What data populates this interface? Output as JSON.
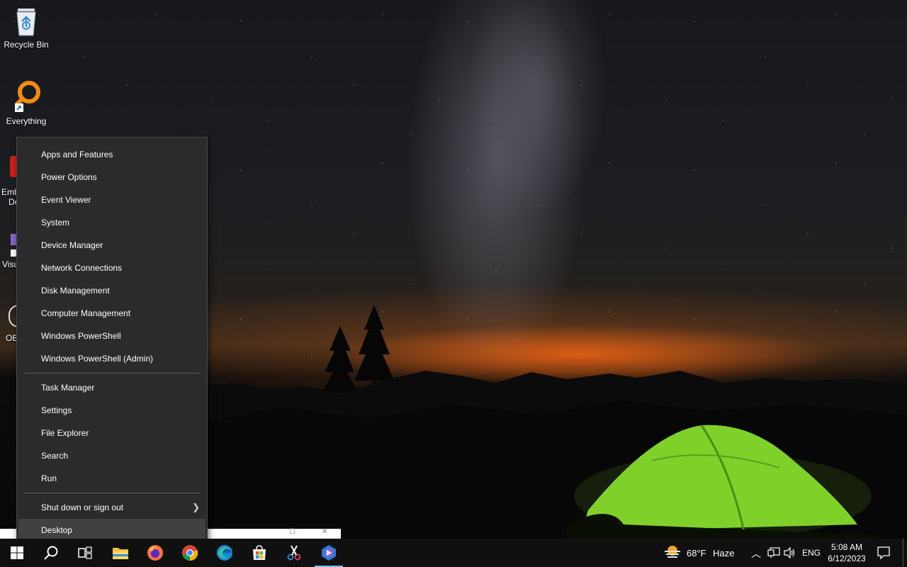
{
  "desktop_icons": [
    {
      "label": "Recycle Bin"
    },
    {
      "label": "Everything"
    }
  ],
  "partial_icons": [
    {
      "line1": "Emb",
      "line2": "De"
    },
    {
      "line1": "Visu"
    },
    {
      "line1": "OB"
    }
  ],
  "context_menu": {
    "group1": [
      {
        "label": "Apps and Features"
      },
      {
        "label": "Power Options"
      },
      {
        "label": "Event Viewer"
      },
      {
        "label": "System"
      },
      {
        "label": "Device Manager"
      },
      {
        "label": "Network Connections"
      },
      {
        "label": "Disk Management"
      },
      {
        "label": "Computer Management"
      },
      {
        "label": "Windows PowerShell"
      },
      {
        "label": "Windows PowerShell (Admin)"
      }
    ],
    "group2": [
      {
        "label": "Task Manager"
      },
      {
        "label": "Settings"
      },
      {
        "label": "File Explorer"
      },
      {
        "label": "Search"
      },
      {
        "label": "Run"
      }
    ],
    "group3": [
      {
        "label": "Shut down or sign out",
        "has_submenu": true
      },
      {
        "label": "Desktop",
        "highlighted": true
      }
    ]
  },
  "taskbar": {
    "apps": [
      "start-icon",
      "search-icon",
      "task-view-icon",
      "file-explorer-icon",
      "firefox-icon",
      "chrome-icon",
      "edge-icon",
      "microsoft-store-icon",
      "snipping-tool-icon",
      "bing-icon"
    ],
    "active_app": "bing-icon",
    "weather": {
      "temp": "68°F",
      "condition": "Haze"
    },
    "language": "ENG",
    "time": "5:08 AM",
    "date": "6/12/2023"
  },
  "colors": {
    "menu_bg": "#2b2b2b",
    "menu_highlight": "#414141",
    "taskbar_bg": "#101010",
    "accent": "#76b9ed",
    "tent": "#7fd12a"
  }
}
